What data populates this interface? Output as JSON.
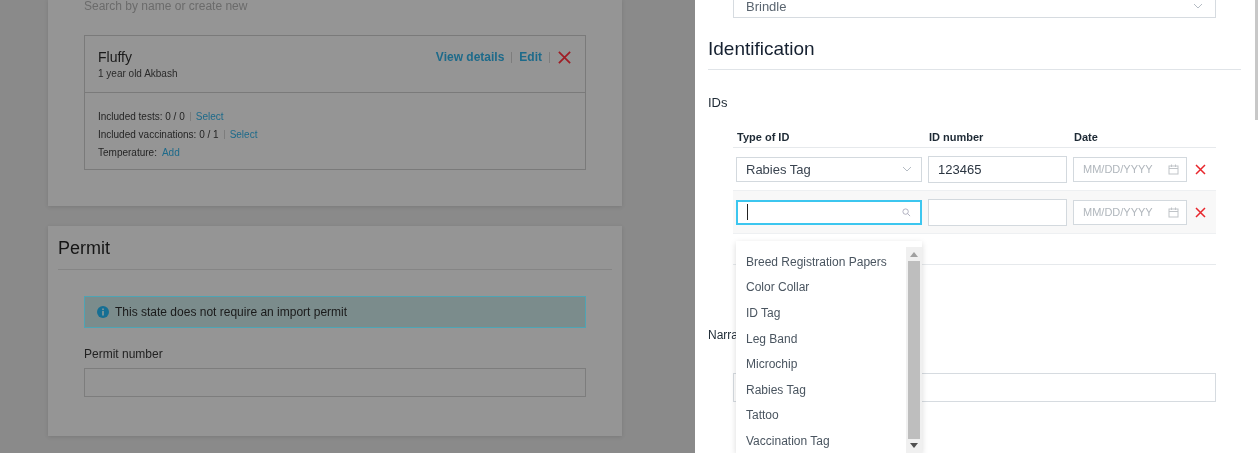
{
  "search": {
    "placeholder": "Search by name or create new"
  },
  "pet": {
    "name": "Fluffy",
    "description": "1 year old Akbash",
    "actions": [
      "View details",
      "Edit"
    ],
    "details": [
      {
        "label": "Included tests: 0 / 0",
        "link": "Select",
        "separator": true
      },
      {
        "label": "Included vaccinations: 0 / 1",
        "link": "Select",
        "separator": true
      },
      {
        "label": "Temperature:",
        "link": "Add",
        "separator": false
      }
    ]
  },
  "permit": {
    "title": "Permit",
    "notice": "This state does not require an import permit",
    "field_label": "Permit number"
  },
  "color_select": {
    "value": "Brindle"
  },
  "identification": {
    "title": "Identification",
    "subtitle": "IDs",
    "columns": [
      "Type of ID",
      "ID number",
      "Date"
    ],
    "rows": [
      {
        "type": "Rabies Tag",
        "number": "123465",
        "date_placeholder": "MM/DD/YYYY",
        "focused": false
      },
      {
        "type": "",
        "number": "",
        "date_placeholder": "MM/DD/YYYY",
        "focused": true
      }
    ],
    "dropdown": [
      "Breed Registration Papers",
      "Color Collar",
      "ID Tag",
      "Leg Band",
      "Microchip",
      "Rabies Tag",
      "Tattoo",
      "Vaccination Tag"
    ]
  },
  "narrative": {
    "title": "Narra"
  }
}
